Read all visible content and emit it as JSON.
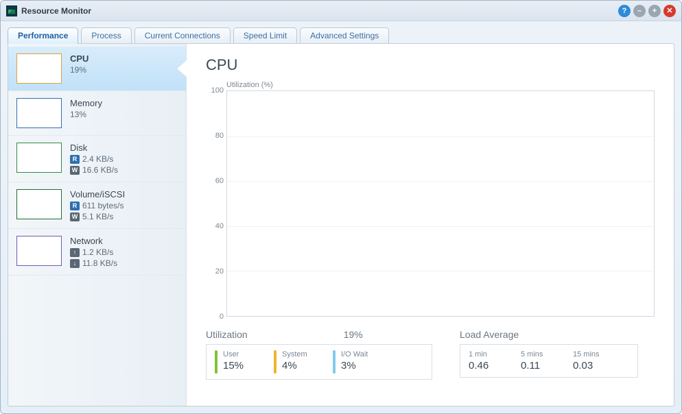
{
  "window": {
    "title": "Resource Monitor"
  },
  "tabs": [
    {
      "label": "Performance",
      "active": true
    },
    {
      "label": "Process",
      "active": false
    },
    {
      "label": "Current Connections",
      "active": false
    },
    {
      "label": "Speed Limit",
      "active": false
    },
    {
      "label": "Advanced Settings",
      "active": false
    }
  ],
  "sidebar": {
    "items": [
      {
        "title": "CPU",
        "stats": [
          {
            "icon": null,
            "text": "19%"
          }
        ],
        "selected": true
      },
      {
        "title": "Memory",
        "stats": [
          {
            "icon": null,
            "text": "13%"
          }
        ],
        "selected": false
      },
      {
        "title": "Disk",
        "stats": [
          {
            "icon": "R",
            "text": "2.4 KB/s"
          },
          {
            "icon": "W",
            "text": "16.6 KB/s"
          }
        ],
        "selected": false
      },
      {
        "title": "Volume/iSCSI",
        "stats": [
          {
            "icon": "R",
            "text": "611 bytes/s"
          },
          {
            "icon": "W",
            "text": "5.1 KB/s"
          }
        ],
        "selected": false
      },
      {
        "title": "Network",
        "stats": [
          {
            "icon": "U",
            "text": "1.2 KB/s"
          },
          {
            "icon": "D",
            "text": "11.8 KB/s"
          }
        ],
        "selected": false
      }
    ]
  },
  "main": {
    "title": "CPU",
    "chart_axis_label": "Utilization (%)",
    "y_ticks": [
      "100",
      "80",
      "60",
      "40",
      "20",
      "0"
    ],
    "utilization": {
      "header_label": "Utilization",
      "header_value": "19%",
      "metrics": [
        {
          "name": "User",
          "value": "15%",
          "barClass": "user"
        },
        {
          "name": "System",
          "value": "4%",
          "barClass": "sys"
        },
        {
          "name": "I/O Wait",
          "value": "3%",
          "barClass": "io"
        }
      ]
    },
    "loadavg": {
      "header_label": "Load Average",
      "items": [
        {
          "name": "1 min",
          "value": "0.46"
        },
        {
          "name": "5 mins",
          "value": "0.11"
        },
        {
          "name": "15 mins",
          "value": "0.03"
        }
      ]
    }
  },
  "chart_data": {
    "type": "line",
    "title": "CPU",
    "ylabel": "Utilization (%)",
    "ylim": [
      0,
      100
    ],
    "y_ticks": [
      0,
      20,
      40,
      60,
      80,
      100
    ],
    "series": [
      {
        "name": "Utilization",
        "values": []
      }
    ],
    "note": "chart area is visually empty in the screenshot"
  }
}
